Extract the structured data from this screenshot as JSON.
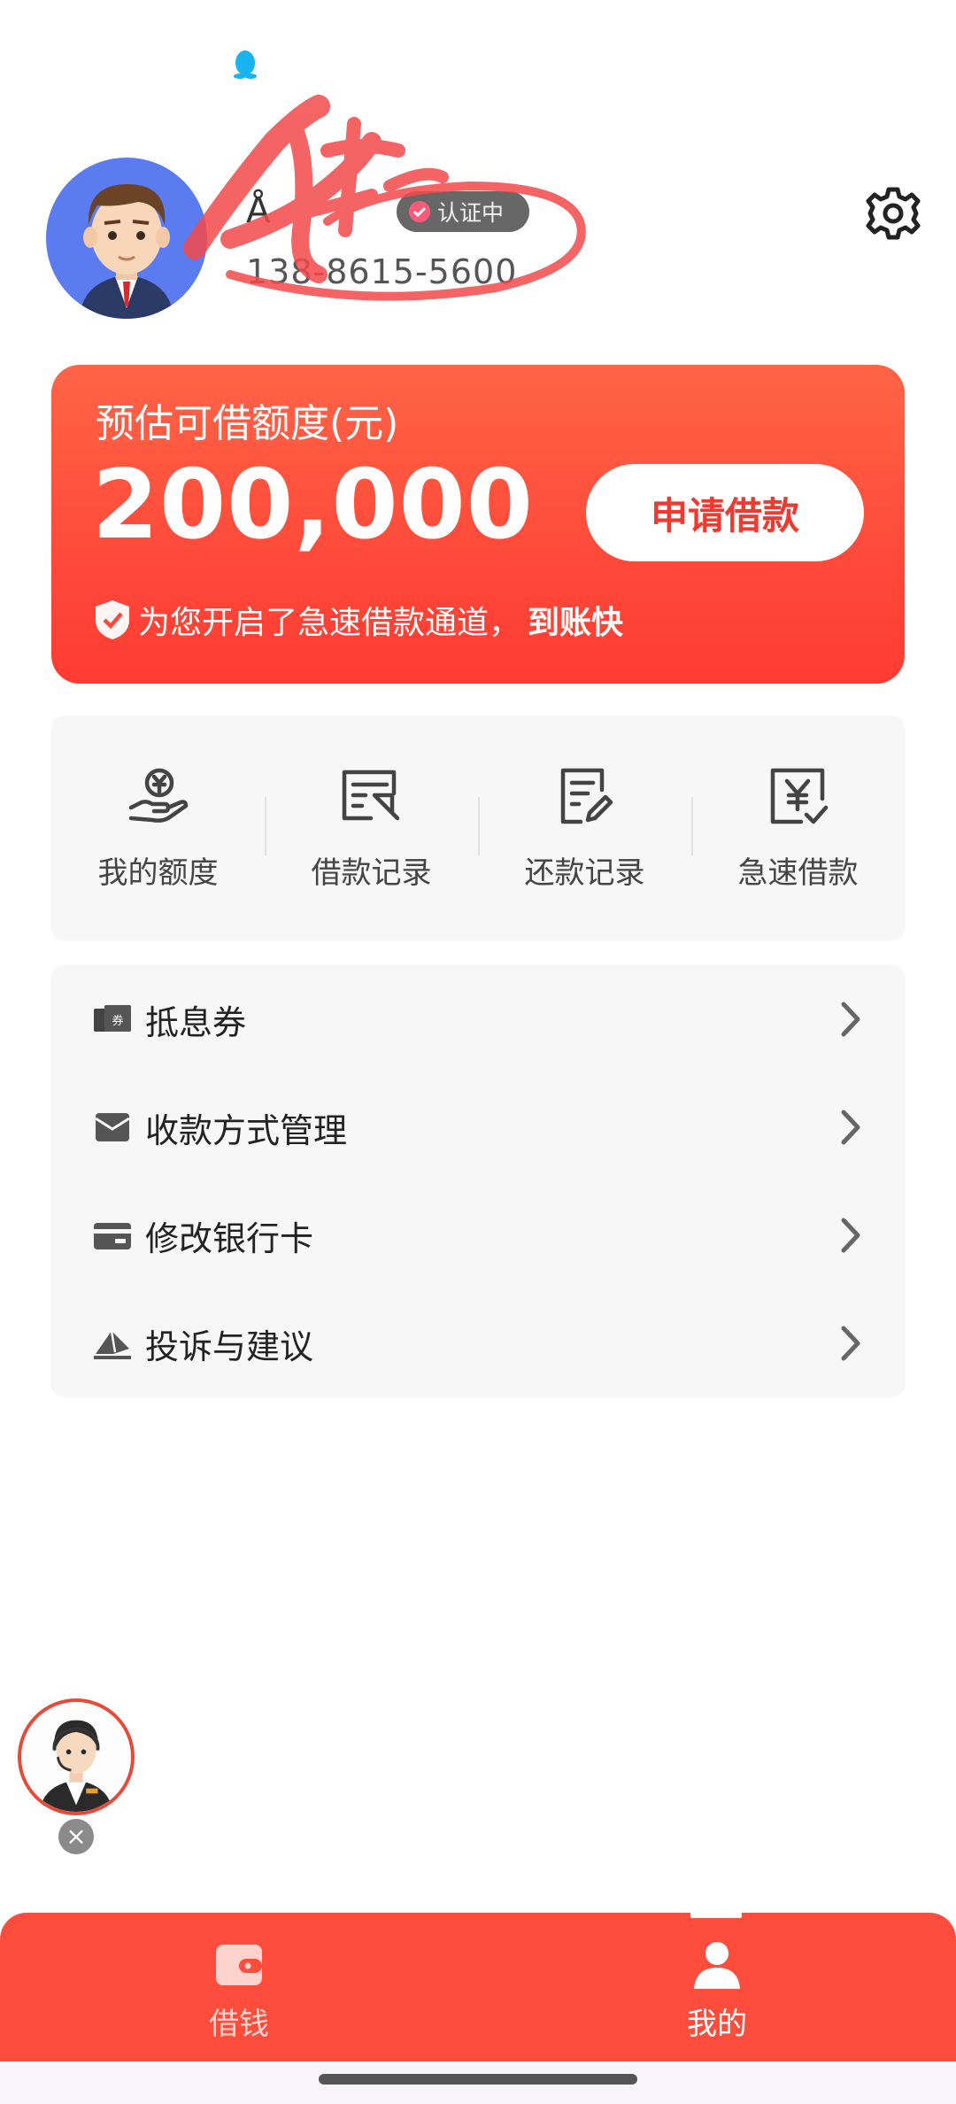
{
  "status_bar": {
    "notification_icon": "qq-penguin-icon"
  },
  "profile": {
    "username": "Å",
    "verify_badge": "认证中",
    "phone": "138-8615-5600"
  },
  "header": {
    "settings_icon": "gear-icon"
  },
  "credit_card": {
    "label": "预估可借额度(元)",
    "amount": "200,000",
    "apply_button": "申请借款",
    "notice_text": "为您开启了急速借款通道，",
    "notice_bold": "到账快"
  },
  "quick_actions": [
    {
      "label": "我的额度",
      "icon": "coin-hand-icon"
    },
    {
      "label": "借款记录",
      "icon": "loan-record-icon"
    },
    {
      "label": "还款记录",
      "icon": "repay-record-icon"
    },
    {
      "label": "急速借款",
      "icon": "yen-check-icon"
    }
  ],
  "menu": [
    {
      "label": "抵息券",
      "icon": "coupon-icon"
    },
    {
      "label": "收款方式管理",
      "icon": "envelope-icon"
    },
    {
      "label": "修改银行卡",
      "icon": "bank-card-icon"
    },
    {
      "label": "投诉与建议",
      "icon": "feedback-icon"
    }
  ],
  "floating_service": {
    "close": "×"
  },
  "tabbar": {
    "tabs": [
      {
        "label": "借钱",
        "icon": "wallet-icon",
        "active": false
      },
      {
        "label": "我的",
        "icon": "person-icon",
        "active": true
      }
    ]
  },
  "colors": {
    "accent": "#ff4d3d",
    "card_top": "#ff6447",
    "card_bottom": "#ff3b33"
  }
}
